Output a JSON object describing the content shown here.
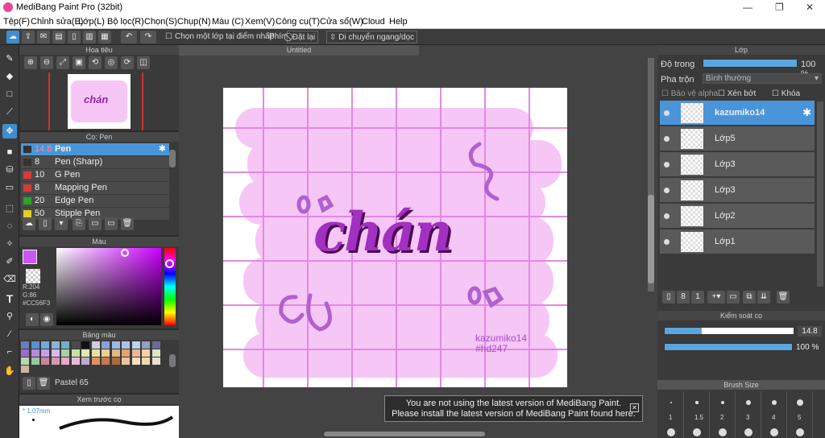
{
  "window": {
    "title": "MediBang Paint Pro (32bit)"
  },
  "menu": [
    "Tệp(F)",
    "Chỉnh sửa(E)",
    "Lớp(L)",
    "Bộ lọc(R)",
    "Chọn(S)",
    "Chụp(N)",
    "Màu (C)",
    "Xem(V)",
    "Công cụ(T)",
    "Cửa sổ(W)",
    "Cloud",
    "Help"
  ],
  "toolbar": {
    "select_one_layer": "Chọn một lớp tại điểm nhấp",
    "keys": "Phím",
    "reset": "Đặt lại",
    "move_hv": "Di chuyển ngang/dọc"
  },
  "navigator": {
    "title": "Hoa tiêu"
  },
  "brush_panel": {
    "title": "Cọ: Pen",
    "items": [
      {
        "size": "14.8",
        "name": "Pen",
        "color": "#333333",
        "selected": true
      },
      {
        "size": "8",
        "name": "Pen (Sharp)",
        "color": "#333333"
      },
      {
        "size": "10",
        "name": "G Pen",
        "color": "#d83a3a"
      },
      {
        "size": "8",
        "name": "Mapping Pen",
        "color": "#d83a3a"
      },
      {
        "size": "20",
        "name": "Edge Pen",
        "color": "#2aa52a"
      },
      {
        "size": "50",
        "name": "Stipple Pen",
        "color": "#e0d020"
      }
    ]
  },
  "color_panel": {
    "title": "Màu",
    "r": "R:204",
    "g": "G:86",
    "hex": "#CC56F3",
    "current": "#CC56F3"
  },
  "palette": {
    "title": "Bảng màu",
    "name": "Pastel 65",
    "colors": [
      "#6b7bbf",
      "#5a8fd0",
      "#74a8d8",
      "#8ab5cf",
      "#6fb0c8",
      "#4a4a4a",
      "#111111",
      "#cbd0d8",
      "#8c9fd4",
      "#9ab9e8",
      "#a8c6e0",
      "#b8d6ec",
      "#8fa0c0",
      "#6a6a9a",
      "#9b6fbf",
      "#b78bd8",
      "#c9a0e8",
      "#d7b8f0",
      "#a9d0a0",
      "#c8e0a8",
      "#dfe8b0",
      "#e8e0a0",
      "#e8d090",
      "#e0b880",
      "#e8a070",
      "#f0b890",
      "#f8d0a8",
      "#d8e8c0",
      "#b8d8b0",
      "#98c8a0",
      "#c88898",
      "#d898b0",
      "#e8a8c8",
      "#f0b8d8",
      "#c0a8d0",
      "#e09060",
      "#c87850",
      "#b06840",
      "#e8c8a0",
      "#f8e0c0",
      "#f0d8b0",
      "#e8e0d0",
      "#c8b8a0"
    ]
  },
  "brush_preview": {
    "title": "Xem trước cọ",
    "size": "1.07mm"
  },
  "canvas": {
    "tab": "Untitled",
    "main_text": "chán",
    "signature_1": "kazumiko14",
    "signature_2": "#hd247",
    "bg_color": "#f6c6f6"
  },
  "layers": {
    "title": "Lớp",
    "opacity_label": "Độ trong",
    "opacity_value": "100 %",
    "blend_label": "Pha trộn",
    "blend_value": "Bình thường",
    "protect_alpha": "Bảo vệ alpha",
    "clipping": "Xén bớt",
    "lock": "Khóa",
    "items": [
      {
        "name": "kazumiko14",
        "selected": true
      },
      {
        "name": "Lớp5"
      },
      {
        "name": "Lớp3"
      },
      {
        "name": "Lớp3"
      },
      {
        "name": "Lớp2"
      },
      {
        "name": "Lớp1"
      }
    ]
  },
  "brush_control": {
    "title": "Kiểm soát cọ",
    "size": "14.8",
    "size_fraction": 0.29,
    "opacity": "100 %",
    "opacity_fraction": 1.0
  },
  "brush_size": {
    "title": "Brush Size",
    "sizes": [
      "1",
      "1.5",
      "2",
      "3",
      "4",
      "5"
    ]
  },
  "notification": {
    "line1": "You are not using the latest version of MediBang Paint.",
    "line2": "Please install the latest version of MediBang Paint found here."
  }
}
